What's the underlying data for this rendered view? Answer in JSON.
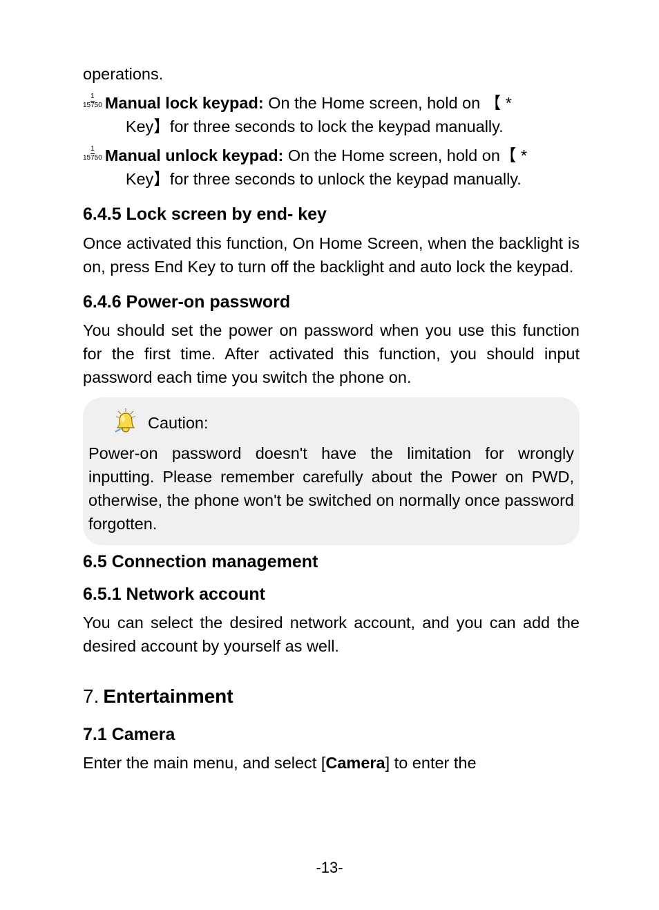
{
  "topFragment": "operations.",
  "bullets": [
    {
      "boldLabel": "Manual lock keypad:",
      "line1_after": " On the Home screen, hold on 【  *",
      "line2": "Key】for three seconds to lock the keypad manually."
    },
    {
      "boldLabel": "Manual unlock keypad:",
      "line1_after": " On the Home screen, hold on【  *",
      "line2": "Key】for three seconds to unlock the keypad manually."
    }
  ],
  "h_645": "6.4.5 Lock screen by end- key",
  "p_645": "Once activated this function, On Home Screen, when the backlight is on, press   End Key   to turn off the backlight and auto lock the keypad.",
  "h_646": "6.4.6 Power-on password",
  "p_646": "You should set the power on password when you use this function for the first time. After activated this function, you should input password each time you switch the phone on.",
  "caution_label": "Caution:",
  "caution_body": "Power-on password doesn't have the limitation for wrongly inputting. Please remember carefully about the Power on PWD, otherwise, the phone won't be switched on normally once password forgotten.",
  "h_65": "6.5 Connection management",
  "h_651": "6.5.1 Network account",
  "p_651": "You can select the desired network account, and you can add the desired account by yourself as well.",
  "chap7_num": "7.",
  "chap7_title": "Entertainment",
  "h_71": "7.1 Camera",
  "p_71_pre": "Enter the main menu, and select [",
  "p_71_bold": "Camera",
  "p_71_post": "] to enter the",
  "page_number": "-13-",
  "fraction": {
    "num": "1",
    "den": "15750"
  }
}
